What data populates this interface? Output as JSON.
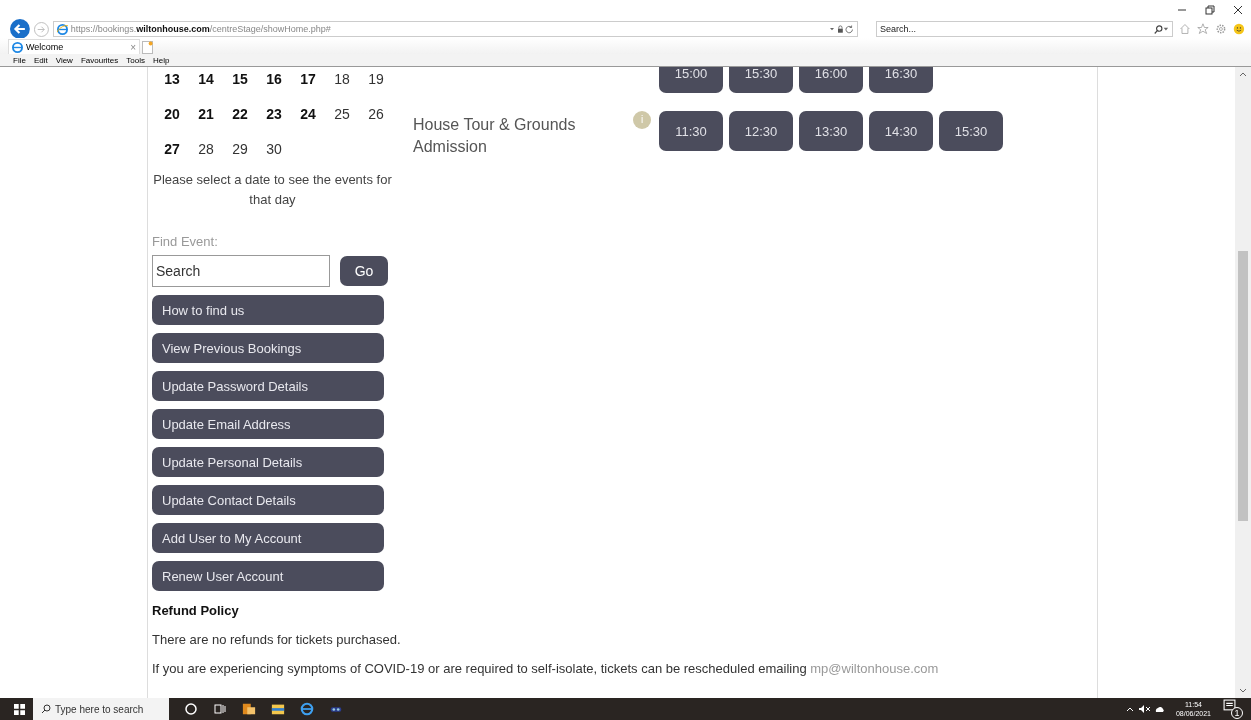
{
  "browser": {
    "address": "https://bookings.**wiltonhouse.com**/centreStage/showHome.php#",
    "search_placeholder": "Search...",
    "tab": {
      "title": "Welcome",
      "close": "×"
    },
    "menu": [
      "File",
      "Edit",
      "View",
      "Favourites",
      "Tools",
      "Help"
    ]
  },
  "calendar": {
    "weeks": [
      [
        {
          "day": "13",
          "bookable": true
        },
        {
          "day": "14",
          "bookable": true
        },
        {
          "day": "15",
          "bookable": true
        },
        {
          "day": "16",
          "bookable": true
        },
        {
          "day": "17",
          "bookable": true
        },
        {
          "day": "18",
          "bookable": false
        },
        {
          "day": "19",
          "bookable": false
        }
      ],
      [
        {
          "day": "20",
          "bookable": true
        },
        {
          "day": "21",
          "bookable": true
        },
        {
          "day": "22",
          "bookable": true
        },
        {
          "day": "23",
          "bookable": true
        },
        {
          "day": "24",
          "bookable": true
        },
        {
          "day": "25",
          "bookable": false
        },
        {
          "day": "26",
          "bookable": false
        }
      ],
      [
        {
          "day": "27",
          "bookable": true
        },
        {
          "day": "28",
          "bookable": false
        },
        {
          "day": "29",
          "bookable": false
        },
        {
          "day": "30",
          "bookable": false
        }
      ]
    ],
    "hint": "Please select a date to see the events for that day"
  },
  "find_event": {
    "label": "Find Event:",
    "placeholder": "Search",
    "button": "Go"
  },
  "account_links": [
    "How to find us",
    "View Previous Bookings",
    "Update Password Details",
    "Update Email Address",
    "Update Personal Details",
    "Update Contact Details",
    "Add User to My Account",
    "Renew User Account"
  ],
  "events": [
    {
      "times": [
        "15:00",
        "15:30",
        "16:00",
        "16:30"
      ]
    },
    {
      "name": "House Tour & Grounds Admission",
      "info": "i",
      "times": [
        "11:30",
        "12:30",
        "13:30",
        "14:30",
        "15:30"
      ]
    }
  ],
  "refund_policy": {
    "heading": "Refund Policy",
    "paragraphs": [
      "There are no refunds for tickets purchased."
    ],
    "covid_note": "If you are experiencing symptoms of COVID-19 or are required to self-isolate, tickets can be rescheduled emailing",
    "email": "mp@wiltonhouse.com"
  },
  "taskbar": {
    "search_placeholder": "Type here to search",
    "time": "11:54",
    "date": "08/06/2021",
    "notifications": "1"
  }
}
